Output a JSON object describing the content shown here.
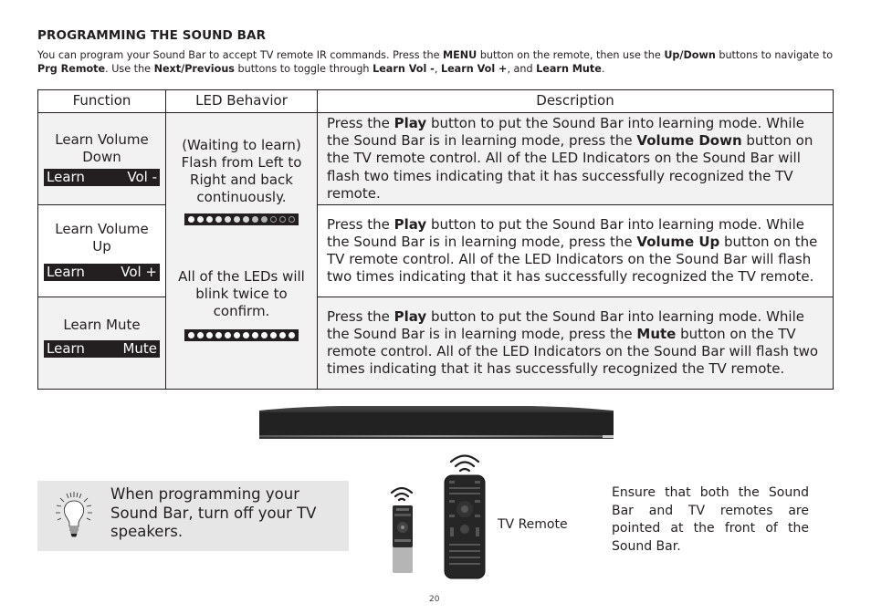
{
  "title": "PROGRAMMING THE SOUND BAR",
  "intro": [
    {
      "t": "You can program your Sound Bar to accept TV remote IR commands. Press the ",
      "b": false
    },
    {
      "t": "MENU",
      "b": true
    },
    {
      "t": " button on the remote, then use the ",
      "b": false
    },
    {
      "t": "Up/Down",
      "b": true
    },
    {
      "t": " buttons to navigate to ",
      "b": false
    },
    {
      "t": "Prg Remote",
      "b": true
    },
    {
      "t": ". Use the ",
      "b": false
    },
    {
      "t": "Next/Previous",
      "b": true
    },
    {
      "t": " buttons to toggle through ",
      "b": false
    },
    {
      "t": "Learn Vol -",
      "b": true
    },
    {
      "t": ", ",
      "b": false
    },
    {
      "t": "Learn Vol +",
      "b": true
    },
    {
      "t": ", and ",
      "b": false
    },
    {
      "t": "Learn Mute",
      "b": true
    },
    {
      "t": ".",
      "b": false
    }
  ],
  "table": {
    "headers": {
      "function": "Function",
      "led": "LED Behavior",
      "description": "Description"
    },
    "led_waiting": "(Waiting to learn) Flash from Left to Right and back continuously.",
    "led_confirm": "All of the LEDs will blink twice to confirm.",
    "led_waiting_levels": [
      1.0,
      0.95,
      0.9,
      0.85,
      0.8,
      0.75,
      0.7,
      0.55,
      0.45,
      0.0,
      0.0,
      0.0
    ],
    "led_confirm_levels": [
      1,
      1,
      1,
      1,
      1,
      1,
      1,
      1,
      1,
      1,
      1,
      1
    ],
    "rows": [
      {
        "function": "Learn Volume Down",
        "lcd_left": "Learn",
        "lcd_right": "Vol -",
        "description": [
          {
            "t": "Press the ",
            "b": false
          },
          {
            "t": "Play",
            "b": true
          },
          {
            "t": " button to put the Sound Bar into learning mode. While the Sound Bar is in learning mode, press the ",
            "b": false
          },
          {
            "t": "Volume Down",
            "b": true
          },
          {
            "t": " button on the TV remote control. All of the LED Indicators on the Sound Bar will flash two times indicating that it has successfully recognized the TV remote.",
            "b": false
          }
        ]
      },
      {
        "function": "Learn Volume Up",
        "lcd_left": "Learn",
        "lcd_right": "Vol +",
        "description": [
          {
            "t": "Press the ",
            "b": false
          },
          {
            "t": "Play",
            "b": true
          },
          {
            "t": " button to put the Sound Bar into learning mode. While the Sound Bar is in learning mode, press the ",
            "b": false
          },
          {
            "t": "Volume Up",
            "b": true
          },
          {
            "t": " button on the TV remote control. All of the LED Indicators on the Sound Bar will flash two times indicating that it has successfully recognized the TV remote.",
            "b": false
          }
        ]
      },
      {
        "function": "Learn Mute",
        "lcd_left": "Learn",
        "lcd_right": "Mute",
        "description": [
          {
            "t": "Press the ",
            "b": false
          },
          {
            "t": "Play",
            "b": true
          },
          {
            "t": " button to put the Sound Bar into learning mode. While the Sound Bar is in learning mode, press the ",
            "b": false
          },
          {
            "t": "Mute",
            "b": true
          },
          {
            "t": " button on the TV remote control. All of the LED Indicators on the Sound Bar will flash two times indicating that it has successfully recognized the TV remote.",
            "b": false
          }
        ]
      }
    ]
  },
  "tip": {
    "icon": "lightbulb-icon",
    "text": "When programming your Sound Bar, turn off your TV speakers."
  },
  "illustration": {
    "tv_remote_label": "TV Remote",
    "ensure_text": "Ensure that  both the Sound Bar and TV remotes are pointed at the front of the Sound Bar."
  },
  "page_number": "20",
  "colors": {
    "ink": "#231f20",
    "row_gray": "#f2f2f2",
    "tip_bg": "#e6e6e6",
    "device": "#231f20"
  }
}
